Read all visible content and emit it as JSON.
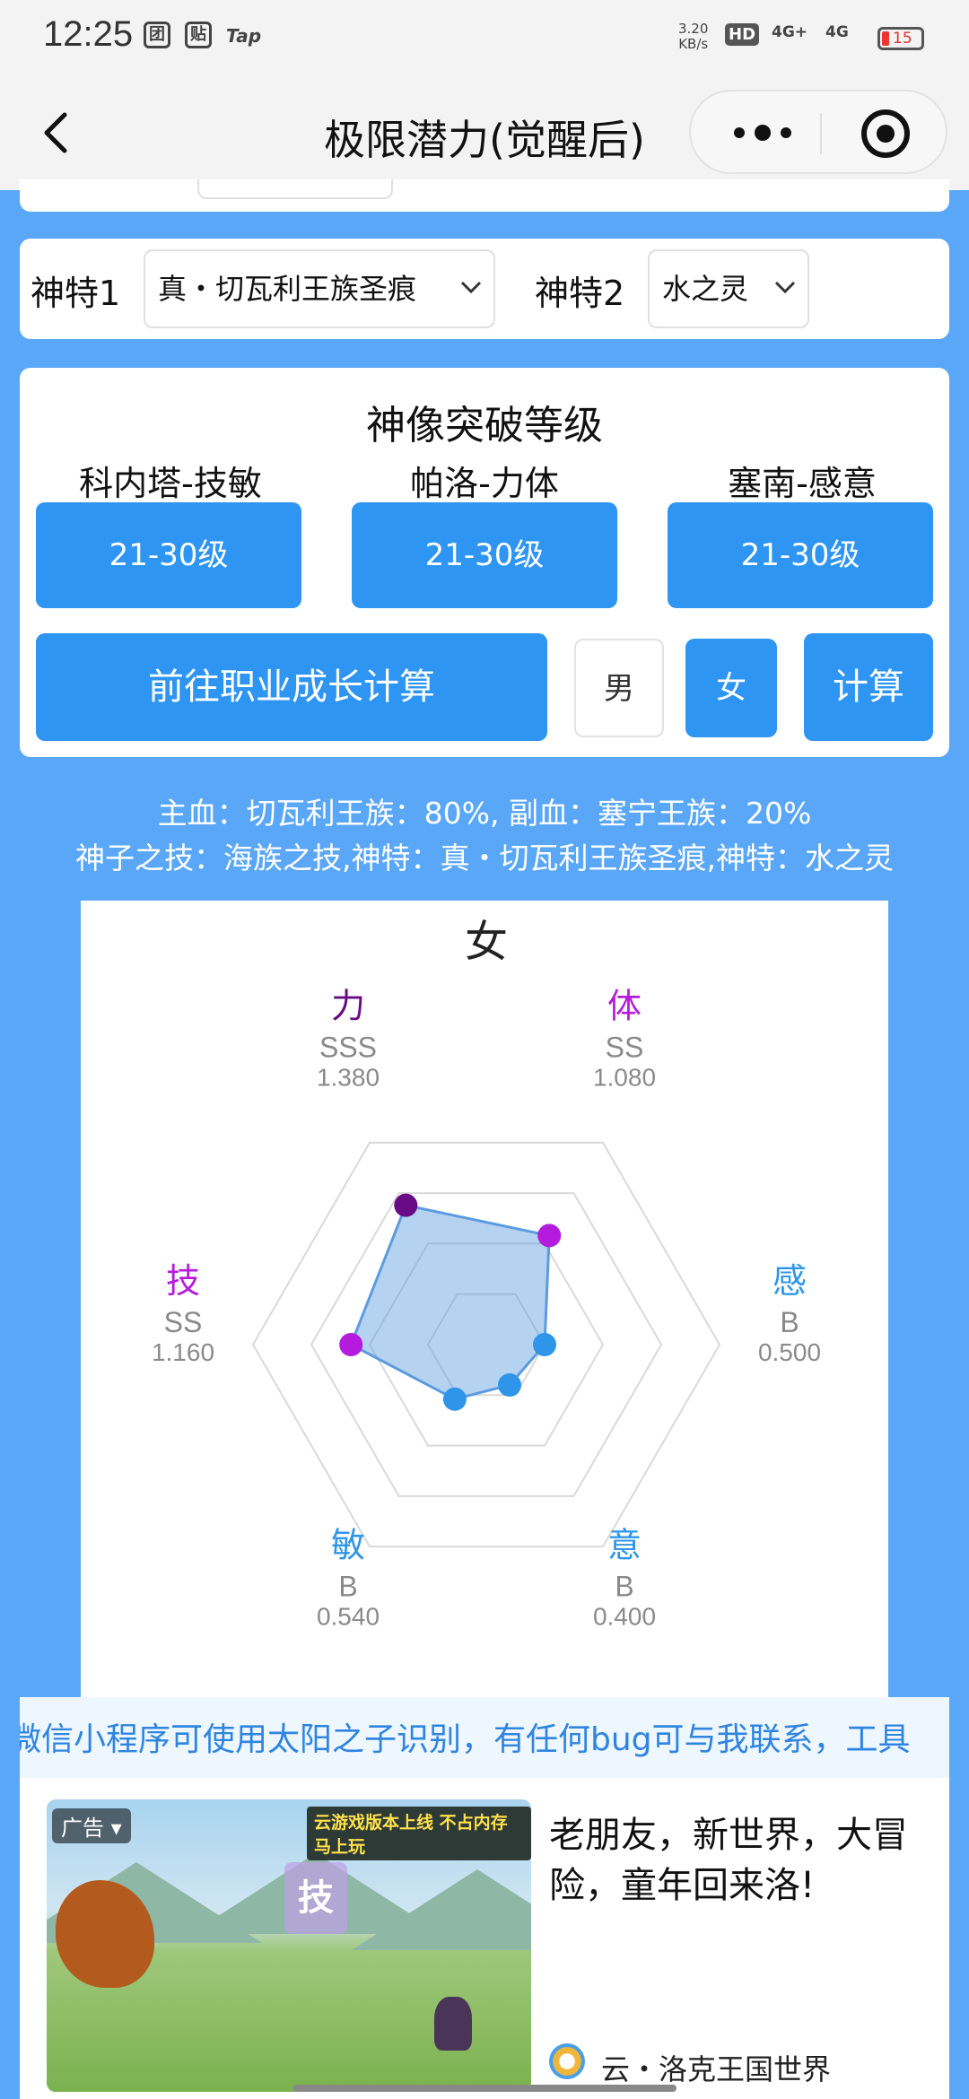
{
  "status_bar": {
    "time": "12:25",
    "icons": [
      "团",
      "贴"
    ],
    "tap_label": "Tap",
    "net_speed_value": "3.20",
    "net_speed_unit": "KB/s",
    "hd_label": "HD",
    "signal_1": "4G+",
    "signal_2": "4G",
    "battery": "15"
  },
  "nav": {
    "title": "极限潜力(觉醒后)"
  },
  "divine_traits": {
    "trait1_label": "神特1",
    "trait1_value": "真・切瓦利王族圣痕",
    "trait2_label": "神特2",
    "trait2_value": "水之灵"
  },
  "statue": {
    "heading": "神像突破等级",
    "groups": [
      {
        "name": "科内塔-技敏",
        "level": "21-30级"
      },
      {
        "name": "帕洛-力体",
        "level": "21-30级"
      },
      {
        "name": "塞南-感意",
        "level": "21-30级"
      }
    ],
    "goto_label": "前往职业成长计算",
    "male_label": "男",
    "female_label": "女",
    "calc_label": "计算"
  },
  "summary": {
    "line1": "主血：切瓦利王族：80%, 副血：塞宁王族：20%",
    "line2": "神子之技：海族之技,神特：真・切瓦利王族圣痕,神特：水之灵"
  },
  "colors": {
    "purple_dark": "#6a0b86",
    "purple": "#b41bdc",
    "blue": "#2f95e8",
    "fill": "#5b9be0"
  },
  "chart_data": {
    "type": "radar",
    "title": "女",
    "axes": [
      {
        "name": "力",
        "grade": "SSS",
        "value": 1.38
      },
      {
        "name": "体",
        "grade": "SS",
        "value": 1.08
      },
      {
        "name": "感",
        "grade": "B",
        "value": 0.5
      },
      {
        "name": "意",
        "grade": "B",
        "value": 0.4
      },
      {
        "name": "敏",
        "grade": "B",
        "value": 0.54
      },
      {
        "name": "技",
        "grade": "SS",
        "value": 1.16
      }
    ],
    "axis_value_labels": [
      "1.380",
      "1.080",
      "0.500",
      "0.400",
      "0.540",
      "1.160"
    ],
    "max": 2.0,
    "rings": 4
  },
  "notice": {
    "text": "微信小程序可使用太阳之子识别，有任何bug可与我联系，工具"
  },
  "ad": {
    "badge": "广告",
    "image_banner": "云游戏版本上线 不占内存马上玩",
    "image_shield_text": "技",
    "title": "老朋友，新世界，大冒险，童年回来洛!",
    "advertiser": "云・洛克王国世界"
  }
}
